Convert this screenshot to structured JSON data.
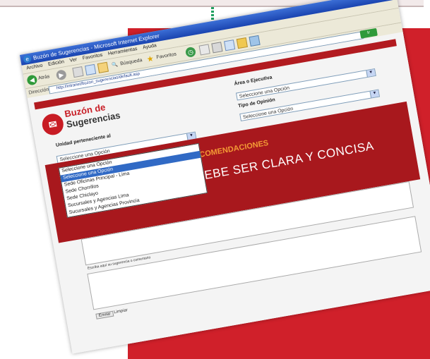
{
  "browser": {
    "title": "Buzón de Sugerencias - Microsoft Internet Explorer",
    "menu": [
      "Archivo",
      "Edición",
      "Ver",
      "Favoritos",
      "Herramientas",
      "Ayuda"
    ],
    "toolbar": {
      "back_label": "Atrás",
      "search_label": "Búsqueda",
      "favorites_label": "Favoritos"
    },
    "address_label": "Dirección",
    "address_value": "http://intranet/buzon_sugerencias/default.asp",
    "go_label": "Ir"
  },
  "page": {
    "logo_line1": "Buzón de",
    "logo_line2": "Sugerencias",
    "left_label": "Unidad perteneciente al",
    "left_select_value": "Seleccione una Opción",
    "dropdown_options": [
      "Seleccione una Opción",
      "Seleccione una Opción",
      "Sede Oficinas Principal - Lima",
      "Sede Chorrillos",
      "Sede Chiclayo",
      "Sucursales y Agencias Lima",
      "Sucursales y Agencias Provincia"
    ],
    "area_label": "Área o Ejecutiva",
    "area_select_value": "Seleccione una Opción",
    "tipo_label": "Tipo de Opinión",
    "tipo_select_value": "Seleccione una Opción",
    "recommendations_title": "RECOMENDACIONES",
    "recommendations_main": "TU SUGERENCIA DEBE SER CLARA Y CONCISA",
    "textarea_label": "Escriba aquí su sugerencia o comentario",
    "send_label": "Enviar",
    "clear_label": "Limpiar"
  },
  "colors": {
    "panel_red": "#d0202a",
    "arrow_green": "#20a060",
    "band_red": "#a8181d",
    "accent_orange": "#f39a35"
  }
}
